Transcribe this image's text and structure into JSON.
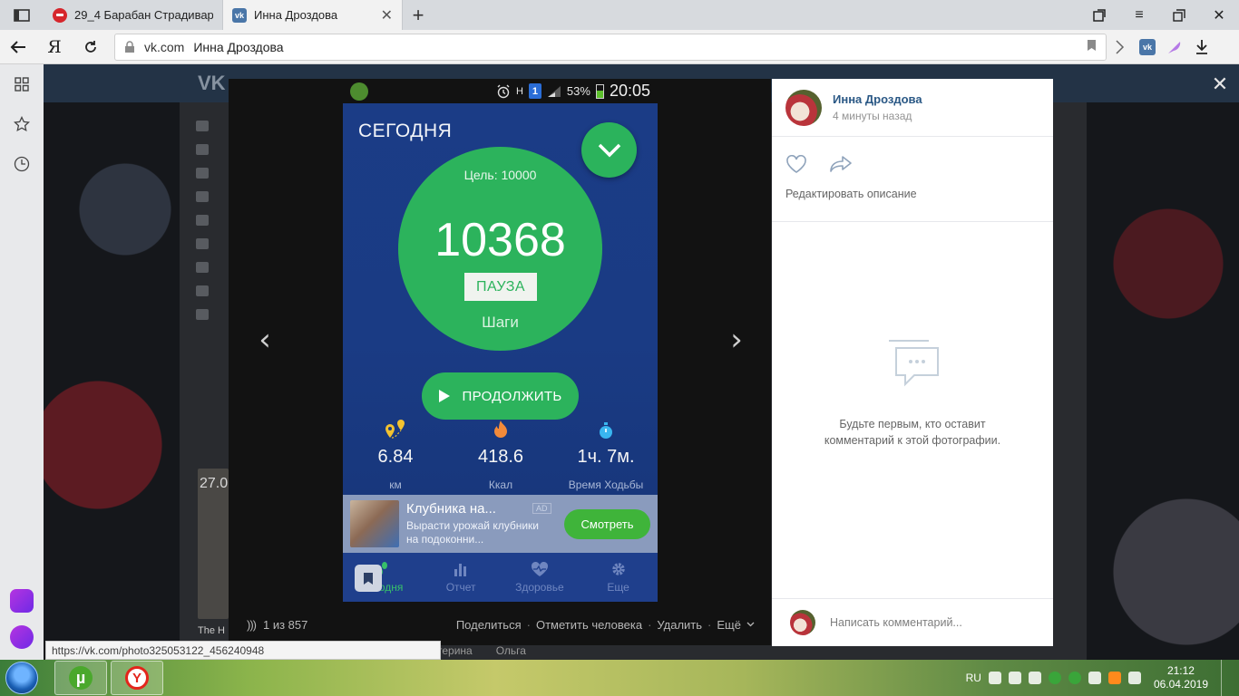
{
  "browser": {
    "tabs": [
      {
        "title": "29_4 Барабан Страдивари",
        "active": false
      },
      {
        "title": "Инна Дроздова",
        "active": true
      }
    ],
    "address": {
      "domain": "vk.com",
      "page_title": "Инна Дроздова",
      "ya_label": "Я"
    },
    "status_url": "https://vk.com/photo325053122_456240948"
  },
  "background_page": {
    "card_label": "27.0",
    "card_title": "The H",
    "bottom_links": [
      "терина",
      "Ольга"
    ]
  },
  "viewer": {
    "counter": "1 из 857",
    "actions": [
      "Поделиться",
      "Отметить человека",
      "Удалить",
      "Ещё"
    ]
  },
  "phone": {
    "status": {
      "battery": "53%",
      "time": "20:05",
      "sim": "1"
    },
    "today_title": "СЕГОДНЯ",
    "goal": "Цель: 10000",
    "steps": "10368",
    "pause": "ПАУЗА",
    "steps_label": "Шаги",
    "continue": "ПРОДОЛЖИТЬ",
    "stats": [
      {
        "value": "6.84",
        "unit": "км",
        "icon": "map-pin-icon",
        "color": "#f2c230"
      },
      {
        "value": "418.6",
        "unit": "Ккал",
        "icon": "flame-icon",
        "color": "#f28a3a"
      },
      {
        "value": "1ч. 7м.",
        "unit": "Время Ходьбы",
        "icon": "stopwatch-icon",
        "color": "#39b6f0"
      }
    ],
    "ad": {
      "title": "Клубника на...",
      "desc": "Вырасти урожай клубники на подоконни...",
      "tag": "AD",
      "cta": "Смотреть"
    },
    "nav": [
      {
        "label": "Сегодня",
        "active": true
      },
      {
        "label": "Отчет",
        "active": false
      },
      {
        "label": "Здоровье",
        "active": false
      },
      {
        "label": "Еще",
        "active": false
      }
    ]
  },
  "info_panel": {
    "author": "Инна Дроздова",
    "time": "4 минуты назад",
    "edit_description": "Редактировать описание",
    "empty_line1": "Будьте первым, кто оставит",
    "empty_line2": "комментарий к этой фотографии.",
    "comment_placeholder": "Написать комментарий..."
  },
  "taskbar": {
    "lang": "RU",
    "time": "21:12",
    "date": "06.04.2019"
  },
  "colors": {
    "vk_link": "#2a5885",
    "app_green": "#2cb35c",
    "phone_bg": "#1b3c86"
  }
}
